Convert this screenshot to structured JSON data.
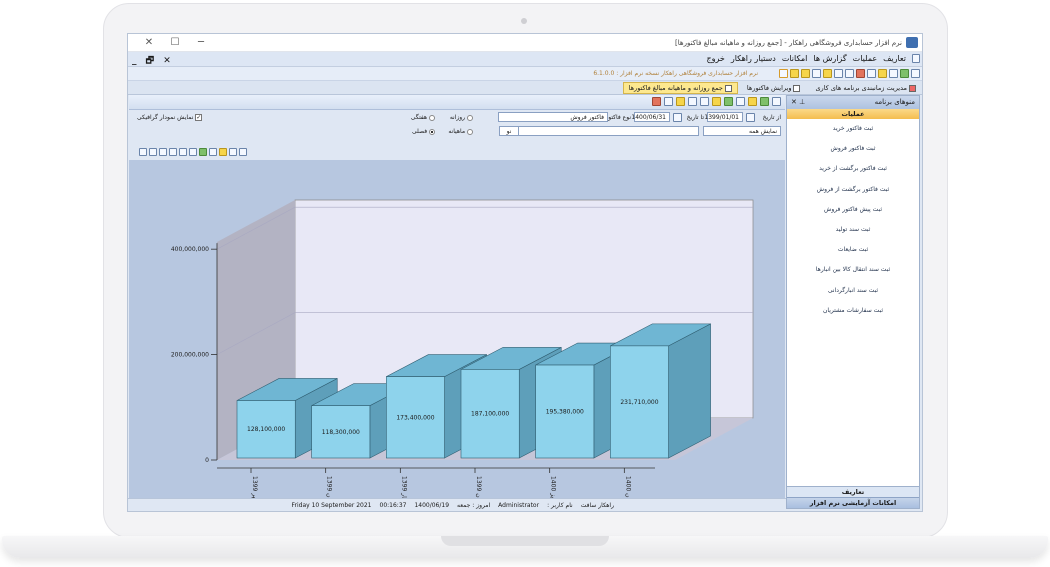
{
  "window": {
    "title": "نرم افزار حسابداری فروشگاهی راهکار - [جمع روزانه و ماهیانه مبالغ فاکتورها]",
    "controls": [
      "─",
      "☐",
      "✕"
    ],
    "mdi_controls": "_ 🗗 ✕"
  },
  "menu": {
    "items": [
      "تعاریف",
      "عملیات",
      "گزارش ها",
      "امکانات",
      "دستیار راهکار",
      "خروج"
    ]
  },
  "app_version_text": "نرم افزار حسابداری فروشگاهی راهکار  نسخه نرم افزار : 6.1.0.0",
  "tabs": [
    {
      "label": "مدیریت زمانبندی برنامه های کاری",
      "active": false
    },
    {
      "label": "ویرایش فاکتورها",
      "active": false
    },
    {
      "label": "جمع روزانه و ماهیانه مبالغ فاکتورها",
      "active": true
    }
  ],
  "filters": {
    "from_date_label": "از تاریخ",
    "from_date": "1399/01/01",
    "to_date_label": "تا تاریخ",
    "to_date": "1400/06/31",
    "invoice_type_label": "نوع فاکتور",
    "invoice_type": "فاکتور فروش",
    "show_all": "نمایش همه",
    "new_button": "نو",
    "period_daily": "روزانه",
    "period_weekly": "هفتگی",
    "period_monthly": "ماهیانه",
    "period_seasonal": "فصلی",
    "selected_period": "فصلی",
    "show_chart_label": "نمایش نمودار گرافیکی"
  },
  "sidebar": {
    "title": "منوهای برنامه",
    "section": "عملیات",
    "items": [
      "ثبت فاکتور خرید",
      "ثبت فاکتور فروش",
      "ثبت فاکتور برگشت از خرید",
      "ثبت فاکتور برگشت از فروش",
      "ثبت پیش فاکتور فروش",
      "ثبت سند تولید",
      "ثبت ضایعات",
      "ثبت سند انتقال کالا بین انبارها",
      "ثبت سند انبارگردانی",
      "ثبت سفارشات مشتریان"
    ],
    "footer_definitions": "تعاریف",
    "footer_trial": "امکانات آزمایشی نرم افزار"
  },
  "status": {
    "company": "راهکار سافت",
    "username_label": "نام کاربر :",
    "username": "Administrator",
    "today_label": "امروز : جمعه",
    "today_date": "1400/06/19",
    "time": "00:16:37",
    "gregorian_date": "Friday 10 September 2021"
  },
  "chart_data": {
    "type": "bar",
    "categories": [
      "مهر 1399",
      "زمستان 1399",
      "بهار 1399",
      "تابستان 1399",
      "پاییز 1400",
      "تابستان 1400"
    ],
    "values": [
      128100000,
      118300000,
      173400000,
      187100000,
      195380000,
      231710000
    ],
    "value_labels": [
      "128,100,000",
      "118,300,000",
      "173,400,000",
      "187,100,000",
      "195,380,000",
      "231,710,000"
    ],
    "y_ticks": [
      "0",
      "200,000,000",
      "400,000,000"
    ],
    "ylim": [
      0,
      400000000
    ],
    "three_d": true,
    "colors": {
      "bar_front": "#8ed3ec",
      "bar_top": "#6fb6d3",
      "bar_side": "#5e9fba",
      "back_wall": "#e8e8f6",
      "side_wall": "#b3b3c3",
      "floor": "#c6c6d8",
      "page": "#b7c7e0"
    }
  }
}
